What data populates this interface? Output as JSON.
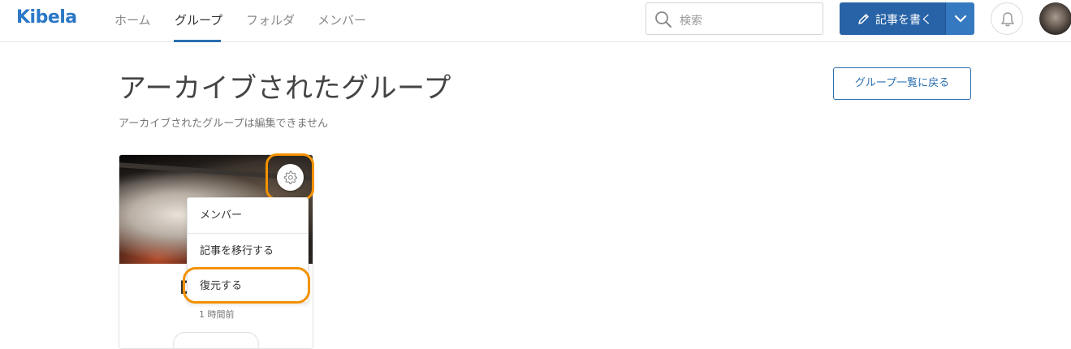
{
  "app": {
    "logo": "Kibela"
  },
  "nav": {
    "items": [
      {
        "label": "ホーム",
        "active": false
      },
      {
        "label": "グループ",
        "active": true
      },
      {
        "label": "フォルダ",
        "active": false
      },
      {
        "label": "メンバー",
        "active": false
      }
    ]
  },
  "search": {
    "placeholder": "検索"
  },
  "write": {
    "label": "記事を書く"
  },
  "page": {
    "title": "アーカイブされたグループ",
    "subtitle": "アーカイブされたグループは編集できません",
    "back_label": "グループ一覧に戻る"
  },
  "card": {
    "name": "D",
    "time": "1 時間前"
  },
  "menu": {
    "items": [
      {
        "label": "メンバー"
      },
      {
        "label": "記事を移行する"
      },
      {
        "label": "復元する"
      }
    ]
  },
  "colors": {
    "accent": "#2a6fb0",
    "highlight": "#f39200"
  }
}
